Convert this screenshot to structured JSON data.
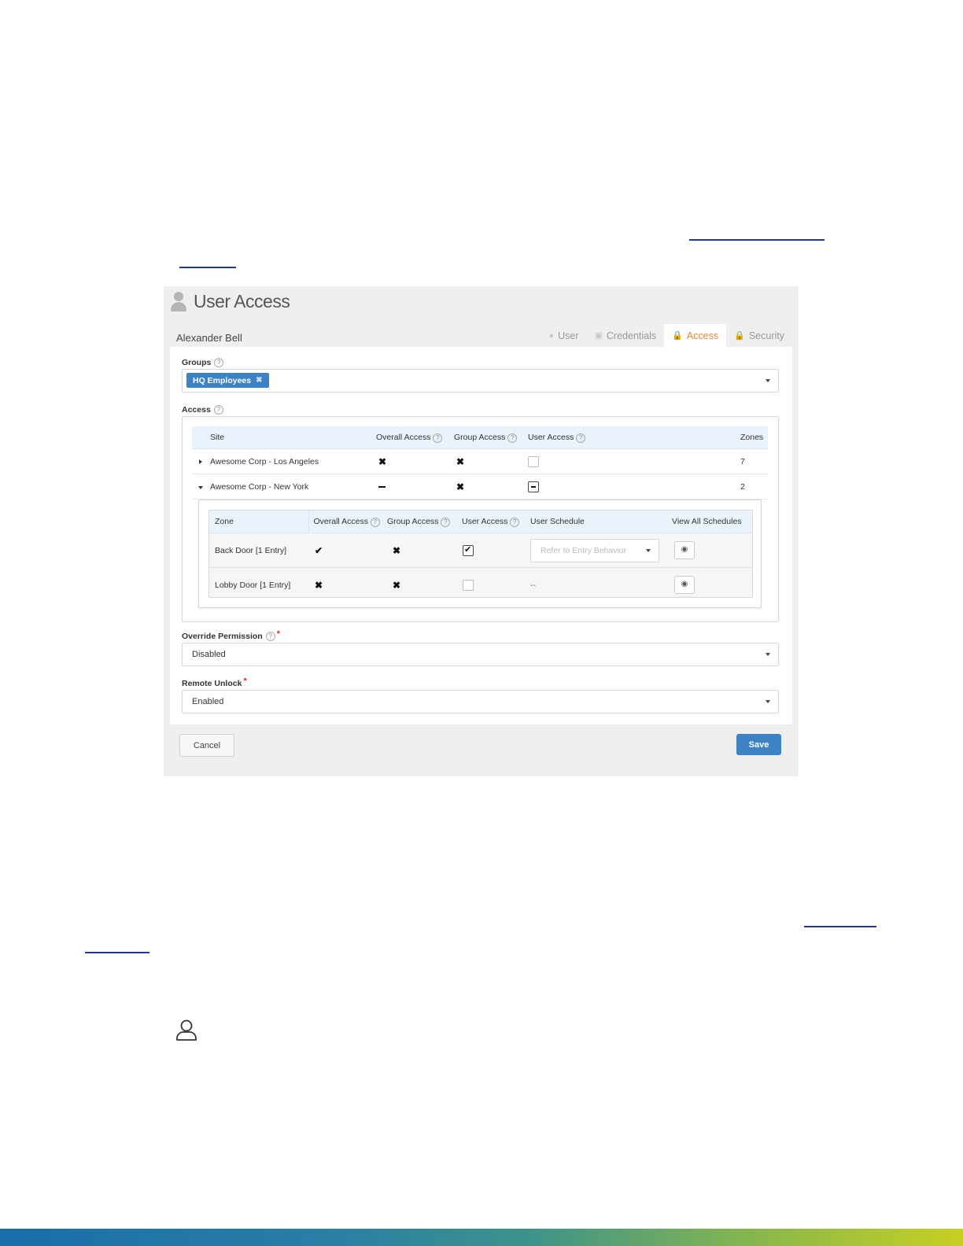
{
  "screen": {
    "title": "User Access",
    "user_name": "Alexander Bell",
    "tabs": [
      {
        "label": "User",
        "icon": "user-icon",
        "active": false
      },
      {
        "label": "Credentials",
        "icon": "credentials-icon",
        "active": false
      },
      {
        "label": "Access",
        "icon": "lock-icon",
        "active": true
      },
      {
        "label": "Security",
        "icon": "lock-icon",
        "active": false
      }
    ],
    "groups": {
      "label": "Groups",
      "selected_tag": "HQ Employees"
    },
    "access": {
      "label": "Access",
      "site_columns": [
        "Site",
        "Overall Access",
        "Group Access",
        "User Access",
        "Zones"
      ],
      "sites": [
        {
          "name": "Awesome Corp - Los Angeles",
          "overall": "denied",
          "group": "denied",
          "user": "unchecked",
          "zones": "7",
          "expanded": false
        },
        {
          "name": "Awesome Corp - New York",
          "overall": "partial",
          "group": "denied",
          "user": "partial",
          "zones": "2",
          "expanded": true
        }
      ],
      "zone_columns": [
        "Zone",
        "Overall Access",
        "Group Access",
        "User Access",
        "User Schedule",
        "View All Schedules"
      ],
      "zones": [
        {
          "name": "Back Door [1 Entry]",
          "overall": "granted",
          "group": "denied",
          "user": "checked",
          "schedule_placeholder": "Refer to Entry Behavior"
        },
        {
          "name": "Lobby Door [1 Entry]",
          "overall": "denied",
          "group": "denied",
          "user": "unchecked",
          "schedule_text": "--"
        }
      ]
    },
    "override_permission": {
      "label": "Override Permission",
      "value": "Disabled"
    },
    "remote_unlock": {
      "label": "Remote Unlock",
      "value": "Enabled"
    },
    "buttons": {
      "cancel": "Cancel",
      "save": "Save"
    }
  },
  "colors": {
    "accent_blue": "#3e82c6",
    "active_tab": "#e08a3c",
    "required": "#d9302c",
    "table_header": "#eaf3fb"
  }
}
